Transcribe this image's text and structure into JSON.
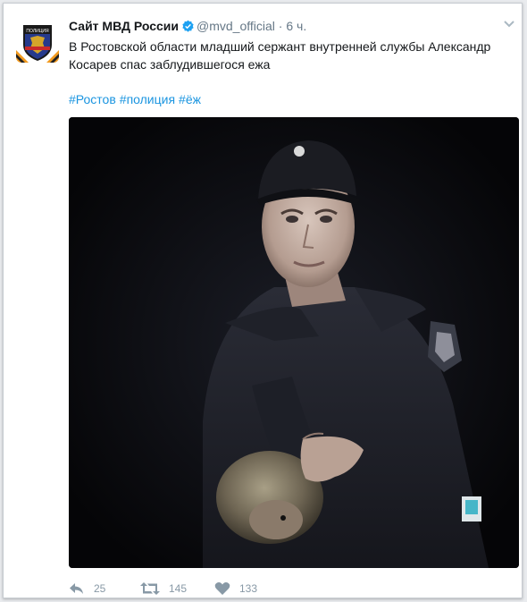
{
  "tweet": {
    "author_name": "Сайт МВД России",
    "handle": "@mvd_official",
    "separator": "·",
    "time": "6 ч.",
    "text": "В Ростовской области младший сержант внутренней службы Александр Косарев спас заблудившегося ежа",
    "hashtags": [
      "#Ростов",
      "#полиция",
      "#ёж"
    ],
    "avatar_badge_text": "ПОЛИЦИЯ"
  },
  "actions": {
    "reply_count": "25",
    "retweet_count": "145",
    "like_count": "133"
  },
  "icons": [
    "verified-badge-icon",
    "chevron-down-icon",
    "reply-icon",
    "retweet-icon",
    "like-icon"
  ],
  "colors": {
    "link": "#1b95e0",
    "verified": "#1da1f2",
    "muted": "#657786",
    "action_icon": "#8899a6"
  }
}
